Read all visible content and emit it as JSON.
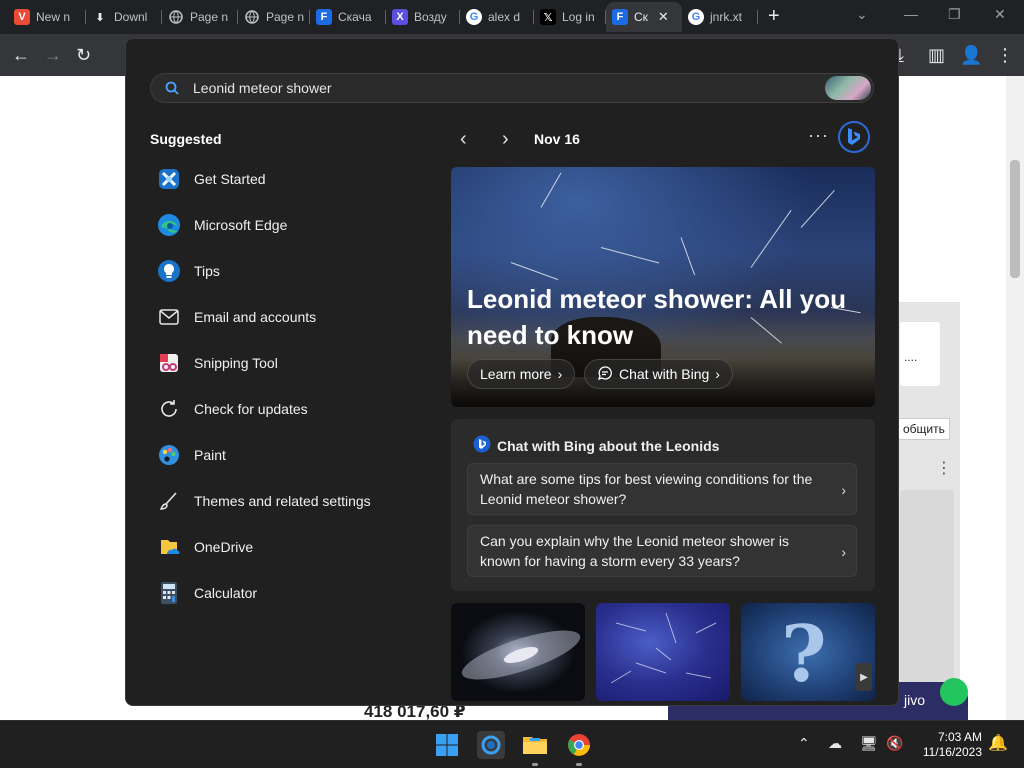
{
  "browser": {
    "tabs": [
      {
        "label": "New n",
        "icon": "vivaldi-icon",
        "color": "#e94b35"
      },
      {
        "label": "Downl",
        "icon": "download-icon",
        "color": "#5f6368"
      },
      {
        "label": "Page n",
        "icon": "globe-icon",
        "color": "#5f6368"
      },
      {
        "label": "Page n",
        "icon": "globe-icon",
        "color": "#5f6368"
      },
      {
        "label": "Скача",
        "icon": "f-logo-icon",
        "color": "#1d6ae5"
      },
      {
        "label": "Возду",
        "icon": "x-logo-purple-icon",
        "color": "#5b4ee0"
      },
      {
        "label": "alex d",
        "icon": "google-icon",
        "color": "#ffffff"
      },
      {
        "label": "Log in",
        "icon": "x-twitter-icon",
        "color": "#000000"
      },
      {
        "label": "Ск",
        "icon": "f-logo-icon",
        "color": "#1d6ae5"
      },
      {
        "label": "jnrk.xt",
        "icon": "google-icon",
        "color": "#ffffff"
      }
    ]
  },
  "background_page": {
    "button_text": "общить",
    "partial_text": "....",
    "price": "418 017,60 ₽",
    "chat_widget": "jivo"
  },
  "search": {
    "query": "Leonid meteor shower"
  },
  "suggested": {
    "title": "Suggested",
    "items": [
      {
        "label": "Get Started",
        "icon": "get-started-icon"
      },
      {
        "label": "Microsoft Edge",
        "icon": "edge-icon"
      },
      {
        "label": "Tips",
        "icon": "tips-lightbulb-icon"
      },
      {
        "label": "Email and accounts",
        "icon": "mail-icon"
      },
      {
        "label": "Snipping Tool",
        "icon": "snipping-tool-icon"
      },
      {
        "label": "Check for updates",
        "icon": "update-refresh-icon"
      },
      {
        "label": "Paint",
        "icon": "paint-palette-icon"
      },
      {
        "label": "Themes and related settings",
        "icon": "brush-icon"
      },
      {
        "label": "OneDrive",
        "icon": "onedrive-icon"
      },
      {
        "label": "Calculator",
        "icon": "calculator-icon"
      }
    ]
  },
  "highlights": {
    "date": "Nov 16",
    "hero_title": "Leonid meteor shower: All you need to know",
    "learn_more": "Learn more",
    "chat_with_bing": "Chat with Bing",
    "chat_card_title": "Chat with Bing about the Leonids",
    "questions": [
      "What are some tips for best viewing conditions for the Leonid meteor shower?",
      "Can you explain why the Leonid meteor shower is known for having a storm every 33 years?"
    ]
  },
  "taskbar": {
    "time": "7:03 AM",
    "date": "11/16/2023"
  },
  "colors": {
    "flyout_bg": "#202020",
    "card_bg": "#2b2b2b",
    "accent_blue": "#2d6ad6",
    "taskbar_bg": "#202020"
  }
}
